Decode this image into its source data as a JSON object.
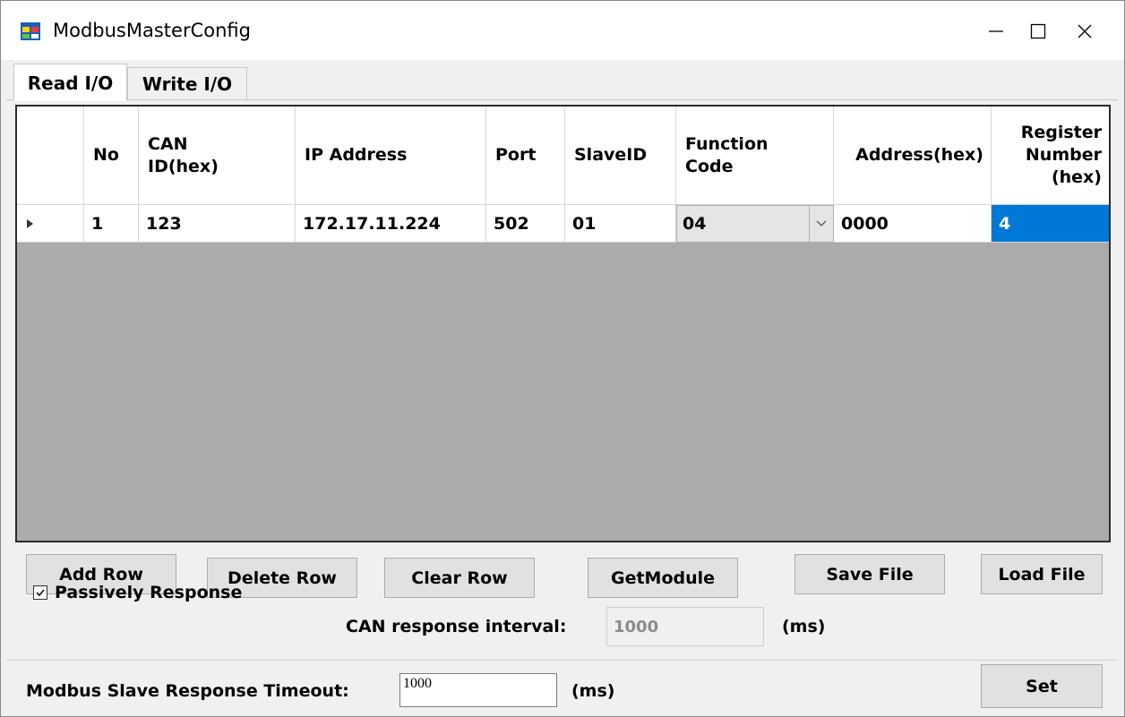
{
  "window": {
    "title": "ModbusMasterConfig",
    "controls": {
      "minimize": "minimize-icon",
      "maximize": "maximize-icon",
      "close": "close-icon"
    }
  },
  "tabs": [
    {
      "label": "Read I/O",
      "active": true
    },
    {
      "label": "Write I/O",
      "active": false
    }
  ],
  "grid": {
    "columns": [
      "No",
      "CAN ID(hex)",
      "IP Address",
      "Port",
      "SlaveID",
      "Function Code",
      "Address(hex)",
      "Register Number (hex)"
    ],
    "header_lines": {
      "can_id": [
        "CAN",
        "ID(hex)"
      ],
      "function_code": [
        "Function",
        "Code"
      ],
      "register_number": [
        "Register",
        "Number",
        "(hex)"
      ]
    },
    "rows": [
      {
        "no": "1",
        "can_id": "123",
        "ip_address": "172.17.11.224",
        "port": "502",
        "slave_id": "01",
        "function_code": "04",
        "address_hex": "0000",
        "register_number_hex": "4"
      }
    ],
    "row_indicator": "current-row-arrow-icon"
  },
  "buttons": {
    "add_row": "Add Row",
    "delete_row": "Delete Row",
    "clear_row": "Clear Row",
    "get_module": "GetModule",
    "save_file": "Save File",
    "load_file": "Load File",
    "set": "Set"
  },
  "passive": {
    "label": "Passively Response",
    "checked": true
  },
  "can_interval": {
    "label": "CAN response interval:",
    "value": "1000",
    "unit": "(ms)",
    "enabled": false
  },
  "timeout": {
    "label": "Modbus Slave Response Timeout:",
    "value": "1000",
    "unit": "(ms)"
  },
  "colors": {
    "selection": "#0078d7",
    "grid_background": "#ababab",
    "window_background": "#f0f0f0"
  }
}
